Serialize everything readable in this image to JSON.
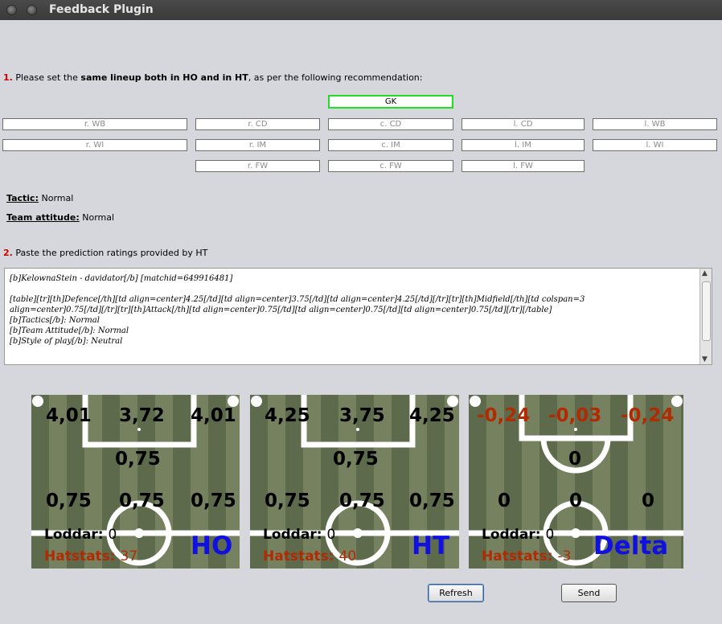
{
  "window": {
    "title": "Feedback Plugin"
  },
  "step1": {
    "num": "1.",
    "pre": "Please set the ",
    "bold": "same lineup both in HO and in HT",
    "post": ", as per the following recommendation:"
  },
  "positions": {
    "gk": "GK",
    "r_wb": "r. WB",
    "r_cd": "r. CD",
    "c_cd": "c. CD",
    "l_cd": "l. CD",
    "l_wb": "l. WB",
    "r_wi": "r. WI",
    "r_im": "r. IM",
    "c_im": "c. IM",
    "l_im": "l. IM",
    "l_wi": "l. WI",
    "r_fw": "r. FW",
    "c_fw": "c. FW",
    "l_fw": "l. FW"
  },
  "tactic": {
    "label": "Tactic:",
    "value": "Normal"
  },
  "attitude": {
    "label": "Team attitude:",
    "value": "Normal"
  },
  "step2": {
    "num": "2.",
    "text": "Paste the prediction ratings provided by HT"
  },
  "prediction_text": "[b]KelownaStein - davidator[/b] [matchid=649916481]\n\n[table][tr][th]Defence[/th][td align=center]4.25[/td][td align=center]3.75[/td][td align=center]4.25[/td][/tr][tr][th]Midfield[/th][td colspan=3\nalign=center]0.75[/td][/tr][tr][th]Attack[/th][td align=center]0.75[/td][td align=center]0.75[/td][td align=center]0.75[/td][/tr][/table]\n[b]Tactics[/b]: Normal\n[b]Team Attitude[/b]: Normal\n[b]Style of play[/b]: Neutral",
  "panels": {
    "ho": {
      "def_r": "4,01",
      "def_c": "3,72",
      "def_l": "4,01",
      "mid": "0,75",
      "att_r": "0,75",
      "att_c": "0,75",
      "att_l": "0,75",
      "loddar_label": "Loddar:",
      "loddar_value": "0",
      "hatstats_label": "Hatstats:",
      "hatstats_value": "37",
      "name": "HO"
    },
    "ht": {
      "def_r": "4,25",
      "def_c": "3,75",
      "def_l": "4,25",
      "mid": "0,75",
      "att_r": "0,75",
      "att_c": "0,75",
      "att_l": "0,75",
      "loddar_label": "Loddar:",
      "loddar_value": "0",
      "hatstats_label": "Hatstats:",
      "hatstats_value": "40",
      "name": "HT"
    },
    "delta": {
      "def_r": "-0,24",
      "def_c": "-0,03",
      "def_l": "-0,24",
      "mid": "0",
      "att_r": "0",
      "att_c": "0",
      "att_l": "0",
      "loddar_label": "Loddar:",
      "loddar_value": "0",
      "hatstats_label": "Hatstats:",
      "hatstats_value": "-3",
      "name": "Delta"
    }
  },
  "buttons": {
    "refresh": "Refresh",
    "send": "Send"
  },
  "colors": {
    "accent_red": "#d00000",
    "gk_border": "#22dd22",
    "rating_blue": "#1010e0",
    "hatstats_red": "#b02a02"
  }
}
